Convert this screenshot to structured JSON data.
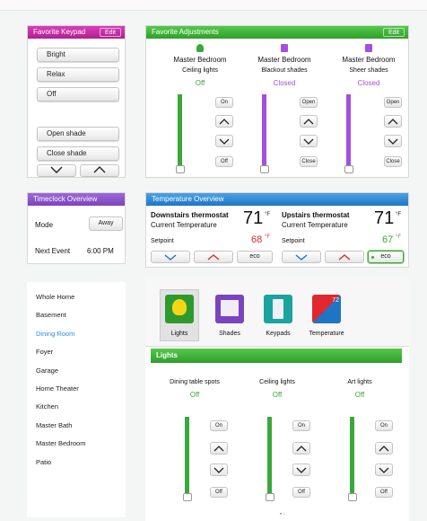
{
  "favorite_keypad": {
    "title": "Favorite Keypad",
    "edit": "Edit",
    "buttons": [
      "Bright",
      "Relax",
      "Off",
      "Open shade",
      "Close shade"
    ]
  },
  "favorite_adjustments": {
    "title": "Favorite Adjustments",
    "edit": "Edit",
    "items": [
      {
        "room": "Master Bedroom",
        "name": "Ceiling lights",
        "status": "Off",
        "top": "On",
        "bottom": "Off",
        "color": "#3aa83a",
        "level": 1.0
      },
      {
        "room": "Master Bedroom",
        "name": "Blackout shades",
        "status": "Closed",
        "top": "Open",
        "bottom": "Close",
        "color": "#a44fe0",
        "level": 1.0
      },
      {
        "room": "Master Bedroom",
        "name": "Sheer shades",
        "status": "Closed",
        "top": "Open",
        "bottom": "Close",
        "color": "#a44fe0",
        "level": 1.0
      }
    ]
  },
  "timeclock": {
    "title": "Timeclock Overview",
    "mode_label": "Mode",
    "mode_value": "Away",
    "next_label": "Next Event",
    "next_value": "6:00 PM"
  },
  "temperature": {
    "title": "Temperature Overview",
    "thermostats": [
      {
        "name": "Downstairs thermostat",
        "sub": "Current Temperature",
        "temp": "71",
        "unit": "°F",
        "setpoint_label": "Setpoint",
        "setpoint": "68",
        "setpoint_unit": "°F",
        "setpoint_color": "#e0282e",
        "eco": "eco"
      },
      {
        "name": "Upstairs thermostat",
        "sub": "Current Temperature",
        "temp": "71",
        "unit": "°F",
        "setpoint_label": "Setpoint",
        "setpoint": "67",
        "setpoint_unit": "°F",
        "setpoint_color": "#3aa83a",
        "eco": "eco"
      }
    ]
  },
  "sidebar": {
    "items": [
      "Whole Home",
      "Basement",
      "Dining Room",
      "Foyer",
      "Garage",
      "Home Theater",
      "Kitchen",
      "Master Bath",
      "Master Bedroom",
      "Patio"
    ],
    "selected": "Dining Room"
  },
  "room": {
    "tabs": [
      {
        "label": "Lights",
        "icon": "lightbulb-icon"
      },
      {
        "label": "Shades",
        "icon": "shade-icon"
      },
      {
        "label": "Keypads",
        "icon": "keypad-icon"
      },
      {
        "label": "Temperature",
        "icon": "thermometer-icon",
        "badge": "72"
      }
    ],
    "section": "Lights",
    "loads": [
      {
        "name": "Dining table spots",
        "status": "Off",
        "top": "On",
        "bottom": "Off",
        "level": 1.0
      },
      {
        "name": "Ceiling lights",
        "status": "Off",
        "top": "On",
        "bottom": "Off",
        "level": 1.0
      },
      {
        "name": "Art lights",
        "status": "Off",
        "top": "On",
        "bottom": "Off",
        "level": 1.0
      }
    ]
  }
}
